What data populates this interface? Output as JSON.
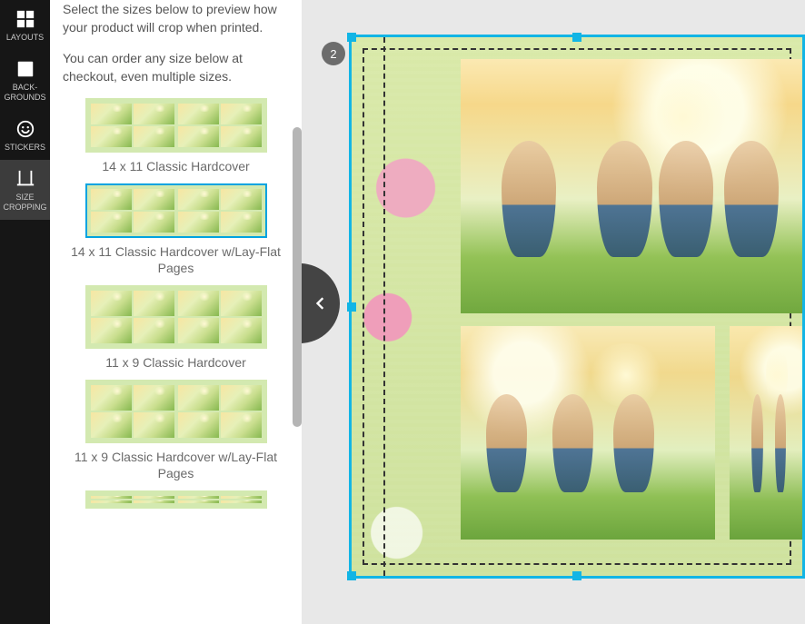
{
  "rail": {
    "items": [
      {
        "name": "layouts",
        "label": "LAYOUTS"
      },
      {
        "name": "backgrounds",
        "label": "BACK-\nGROUNDS"
      },
      {
        "name": "stickers",
        "label": "STICKERS"
      },
      {
        "name": "size-crop",
        "label": "SIZE\nCROPPING"
      }
    ],
    "active": "size-crop"
  },
  "panel": {
    "intro1": "Select the sizes below to preview how your product will crop when printed.",
    "intro2": "You can order any size below at checkout, even multiple sizes.",
    "options": [
      {
        "label": "14 x 11 Classic Hardcover",
        "selected": false,
        "aspect": "h60"
      },
      {
        "label": "14 x 11 Classic Hardcover w/Lay-Flat Pages",
        "selected": true,
        "aspect": "h60"
      },
      {
        "label": "11 x 9 Classic Hardcover",
        "selected": false,
        "aspect": "h70"
      },
      {
        "label": "11 x 9 Classic Hardcover w/Lay-Flat Pages",
        "selected": false,
        "aspect": "h70"
      },
      {
        "label": "",
        "selected": false,
        "aspect": "h70"
      }
    ]
  },
  "canvas": {
    "page_badge": "2",
    "selection_color": "#12b5e5"
  }
}
